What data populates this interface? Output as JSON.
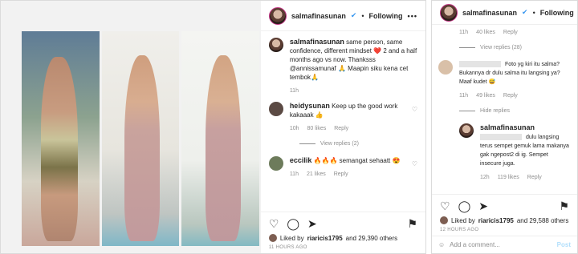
{
  "post": {
    "username": "salmafinasunan",
    "following": "Following",
    "caption": "same person, same confidence, different mindset ❤️ 2 and a half months ago vs now. Thanksss @annissamunaf 🙏 Maapin siku kena cet tembok🙏",
    "caption_time": "11h",
    "comments": [
      {
        "username": "heidysunan",
        "text": "Keep up the good work kakaaak 👍",
        "time": "10h",
        "likes": "80 likes",
        "reply": "Reply",
        "view_replies": "View replies (2)"
      },
      {
        "username": "eccilik",
        "text": "🔥🔥🔥 semangat sehaatt 😍",
        "time": "11h",
        "likes": "21 likes",
        "reply": "Reply"
      }
    ],
    "liked_by_prefix": "Liked by",
    "liked_by_user": "riaricis1795",
    "liked_by_suffix": "and 29,390 others",
    "timestamp": "11 HOURS AGO"
  },
  "right_panel": {
    "username": "salmafinasunan",
    "following": "Following",
    "top_meta": {
      "time": "11h",
      "likes": "40 likes",
      "reply": "Reply"
    },
    "view_replies": "View replies (28)",
    "comment1": {
      "text": "Foto yg kiri itu salma? Bukannya dr dulu salma itu langsing ya? Maaf kudet 😅",
      "time": "11h",
      "likes": "49 likes",
      "reply": "Reply"
    },
    "hide_replies": "Hide replies",
    "reply1": {
      "username": "salmafinasunan",
      "text": "dulu langsing terus sempet gemuk lama makanya gak ngepost2 di ig. Sempet insecure juga.",
      "time": "12h",
      "likes": "119 likes",
      "reply": "Reply"
    },
    "liked_by_prefix": "Liked by",
    "liked_by_user": "riaricis1795",
    "liked_by_suffix": "and 29,588 others",
    "timestamp": "12 HOURS AGO",
    "add_comment_placeholder": "Add a comment...",
    "post_label": "Post"
  }
}
